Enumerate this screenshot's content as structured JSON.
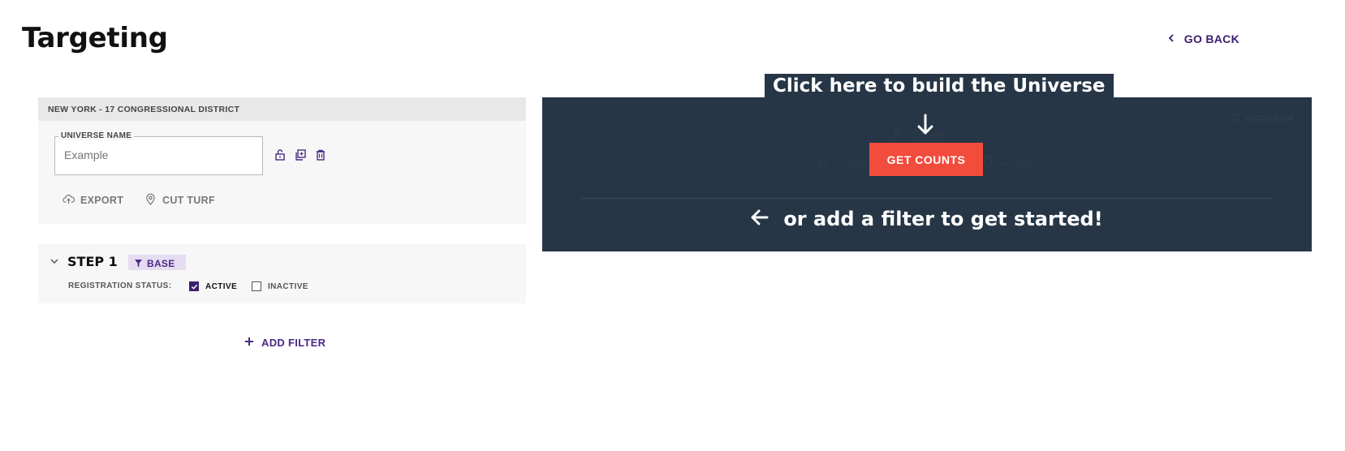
{
  "page": {
    "title": "Targeting"
  },
  "nav": {
    "go_back_label": "GO BACK"
  },
  "universe": {
    "district_header": "NEW YORK - 17 CONGRESSIONAL DISTRICT",
    "name_label": "UNIVERSE NAME",
    "name_placeholder": "Example",
    "name_value": "",
    "actions": {
      "export_label": "EXPORT",
      "cut_turf_label": "CUT TURF"
    },
    "icons": [
      "unlock-icon",
      "copy-icon",
      "trash-icon"
    ]
  },
  "step": {
    "title": "STEP 1",
    "badge_label": "BASE",
    "registration_label": "REGISTRATION STATUS:",
    "options": [
      {
        "label": "ACTIVE",
        "checked": true
      },
      {
        "label": "INACTIVE",
        "checked": false
      }
    ]
  },
  "add_filter_label": "ADD FILTER",
  "counts": {
    "refresh_label": "REFRESH",
    "voters_label": "voters",
    "doors_label": "— doors",
    "cells_label": "— cells",
    "get_counts_label": "GET COUNTS",
    "callout_text": "Click here to build the Universe",
    "filter_hint": "or add a filter to get started!"
  },
  "colors": {
    "accent": "#3a1f6e",
    "cta": "#f24c3d",
    "overlay": "#263646",
    "badge_bg": "#e6dcf2"
  }
}
